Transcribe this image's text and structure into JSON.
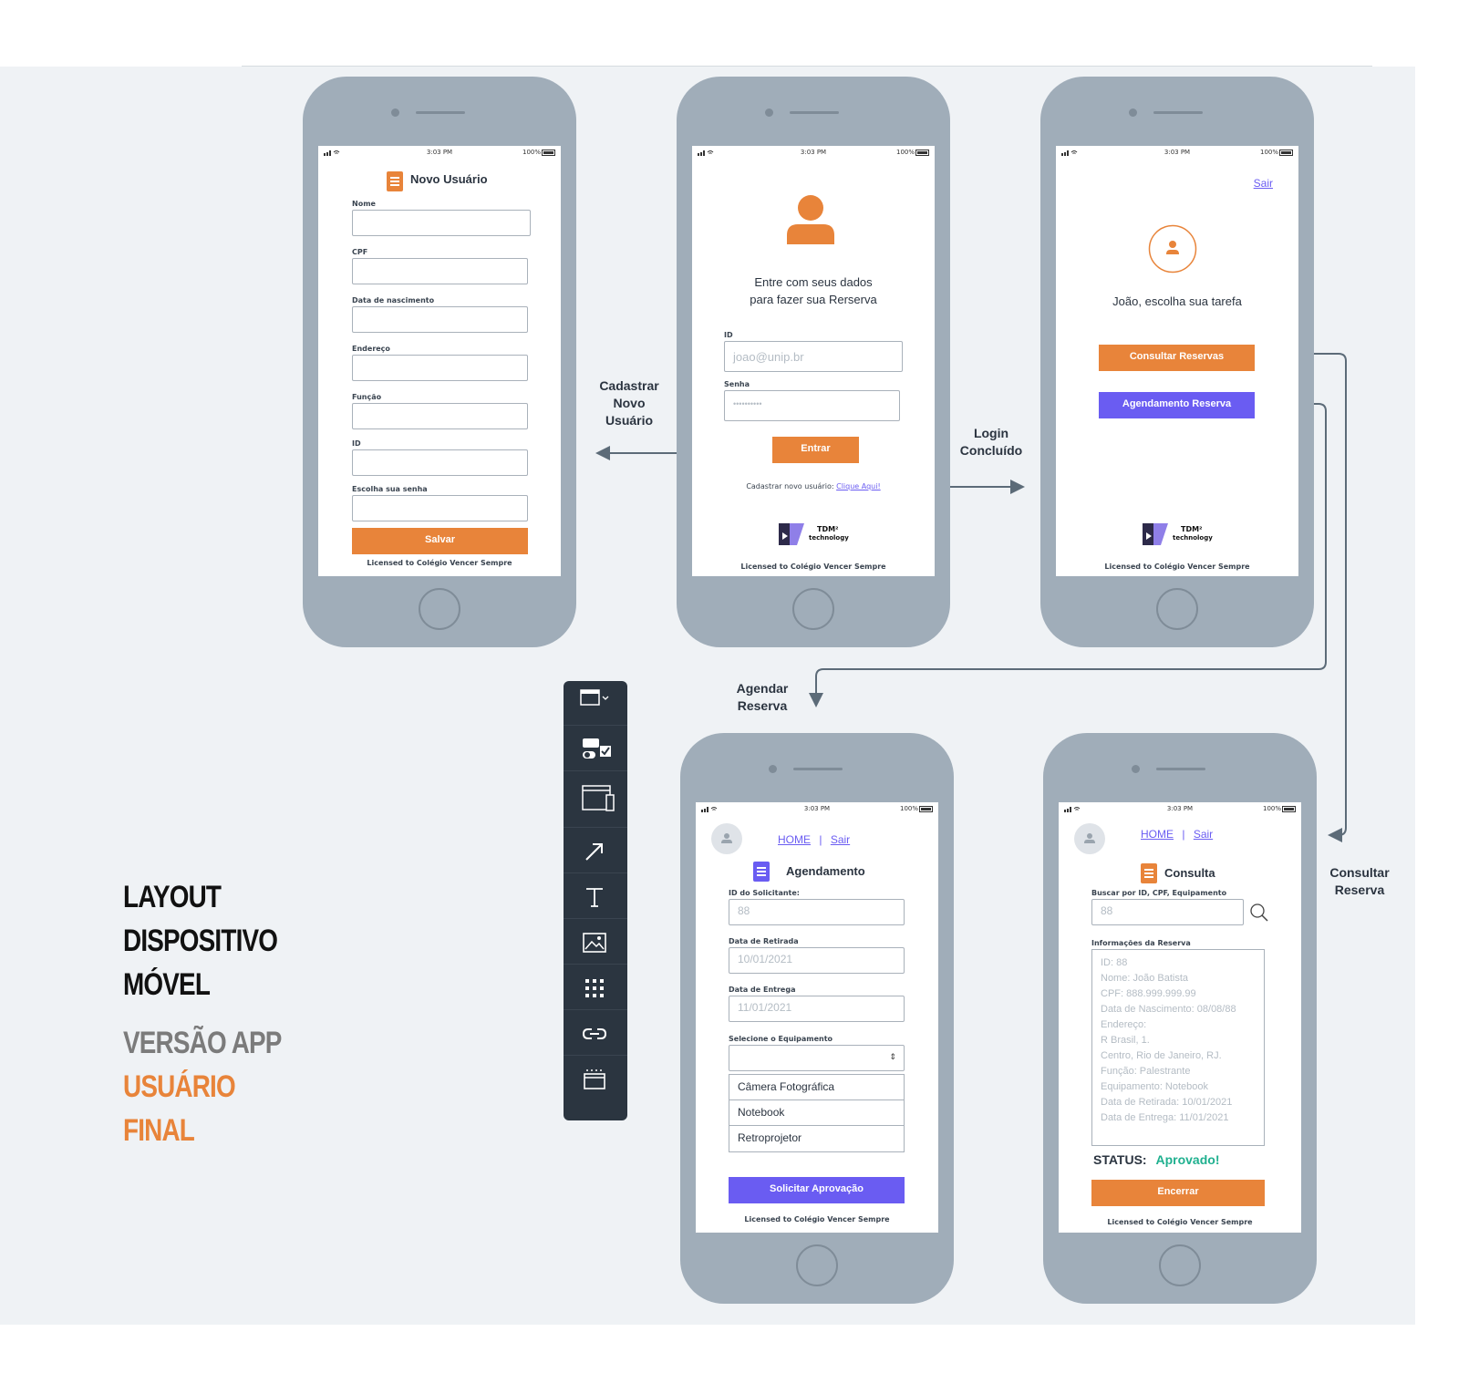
{
  "status_bar": {
    "time": "3:03 PM",
    "battery": "100%"
  },
  "title_block": {
    "line1": "LAYOUT",
    "line2": "DISPOSITIVO",
    "line3": "MÓVEL",
    "line4": "VERSÃO APP",
    "line5": "USUÁRIO",
    "line6": "FINAL"
  },
  "colors": {
    "accent_orange": "#e8843a",
    "accent_purple": "#6a5cf2",
    "status_green": "#1fb08f",
    "phone_frame": "#a0adb9",
    "canvas": "#eff2f5"
  },
  "flow_labels": {
    "cadastrar": [
      "Cadastrar",
      "Novo",
      "Usuário"
    ],
    "login": [
      "Login",
      "Concluído"
    ],
    "agendar": [
      "Agendar",
      "Reserva"
    ],
    "consultar": [
      "Consultar",
      "Reserva"
    ]
  },
  "license": "Licensed to Colégio Vencer Sempre",
  "logo": {
    "name": "TDM²",
    "sub": "technology"
  },
  "register": {
    "title": "Novo Usuário",
    "fields": [
      "Nome",
      "CPF",
      "Data de nascimento",
      "Endereço",
      "Função",
      "ID",
      "Escolha sua senha"
    ],
    "save_label": "Salvar"
  },
  "login": {
    "prompt_line1": "Entre com seus dados",
    "prompt_line2": "para fazer sua Rerserva",
    "id_label": "ID",
    "id_placeholder": "joao@unip.br",
    "password_label": "Senha",
    "password_value": "••••••••••",
    "enter_label": "Entrar",
    "register_text": "Cadastrar novo usuário:",
    "register_link": "Clique Aqui!"
  },
  "home": {
    "logout": "Sair",
    "greeting": "João, escolha sua tarefa",
    "consult_label": "Consultar Reservas",
    "schedule_label": "Agendamento Reserva"
  },
  "schedule": {
    "nav_home": "HOME",
    "nav_sep": "|",
    "nav_logout": "Sair",
    "title": "Agendamento",
    "requester_label": "ID do Solicitante:",
    "requester_value": "88",
    "pickup_label": "Data de Retirada",
    "pickup_value": "10/01/2021",
    "return_label": "Data de Entrega",
    "return_value": "11/01/2021",
    "equipment_label": "Selecione o Equipamento",
    "select_arrow": "⇕",
    "equipment_options": [
      "Câmera Fotográfica",
      "Notebook",
      "Retroprojetor"
    ],
    "submit_label": "Solicitar Aprovação"
  },
  "query": {
    "nav_home": "HOME",
    "nav_sep": "|",
    "nav_logout": "Sair",
    "title": "Consulta",
    "search_label": "Buscar por ID, CPF, Equipamento",
    "search_value": "88",
    "info_label": "Informações da Reserva",
    "info_lines": [
      "ID: 88",
      "Nome: João Batista",
      "CPF: 888.999.999.99",
      "Data de Nascimento: 08/08/88",
      "Endereço:",
      "R Brasil, 1.",
      "Centro, Rio de Janeiro, RJ.",
      "Função: Palestrante",
      "Equipamento: Notebook",
      "Data de Retirada: 10/01/2021",
      "Data de Entrega: 11/01/2021"
    ],
    "status_label": "STATUS:",
    "status_value": "Aprovado!",
    "close_label": "Encerrar"
  },
  "toolbar_icons": [
    "window-dropdown-icon",
    "form-controls-icon",
    "devices-icon",
    "arrow-icon",
    "text-icon",
    "image-icon",
    "grid-icon",
    "link-icon",
    "container-icon"
  ]
}
